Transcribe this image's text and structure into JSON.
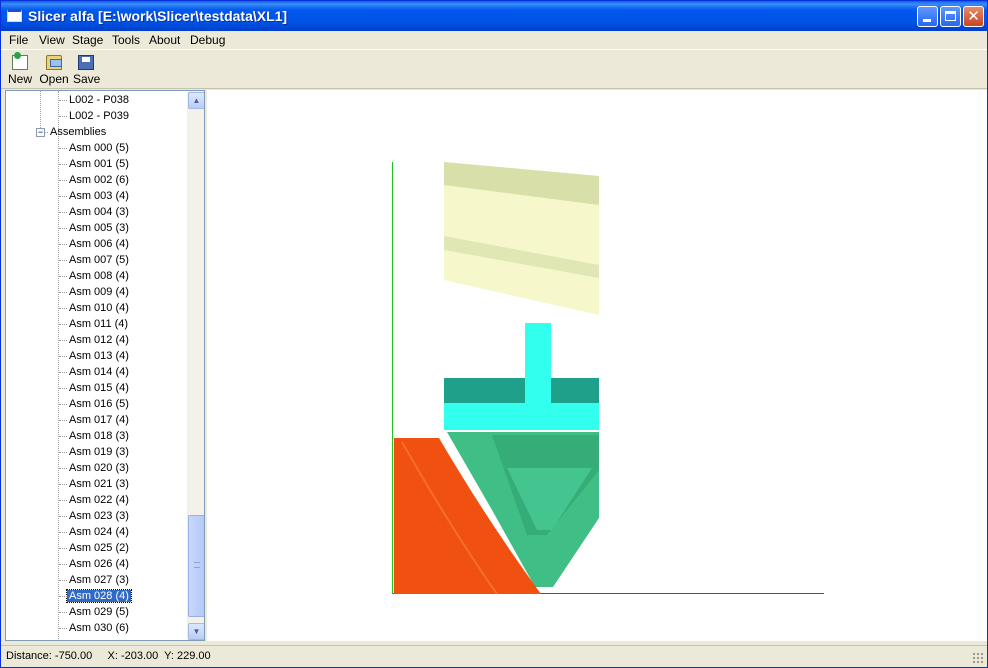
{
  "window": {
    "title": "Slicer alfa [E:\\work\\Slicer\\testdata\\XL1]"
  },
  "menu": [
    "File",
    "View",
    "Stage",
    "Tools",
    "About",
    "Debug"
  ],
  "toolbar": {
    "new_label": "New",
    "open_label": "Open",
    "save_label": "Save"
  },
  "tree": {
    "parts": [
      "L002 - P038",
      "L002 - P039"
    ],
    "group_label": "Assemblies",
    "assemblies": [
      "Asm 000 (5)",
      "Asm 001 (5)",
      "Asm 002 (6)",
      "Asm 003 (4)",
      "Asm 004 (3)",
      "Asm 005 (3)",
      "Asm 006 (4)",
      "Asm 007 (5)",
      "Asm 008 (4)",
      "Asm 009 (4)",
      "Asm 010 (4)",
      "Asm 011 (4)",
      "Asm 012 (4)",
      "Asm 013 (4)",
      "Asm 014 (4)",
      "Asm 015 (4)",
      "Asm 016 (5)",
      "Asm 017 (4)",
      "Asm 018 (3)",
      "Asm 019 (3)",
      "Asm 020 (3)",
      "Asm 021 (3)",
      "Asm 022 (4)",
      "Asm 023 (3)",
      "Asm 024 (4)",
      "Asm 025 (2)",
      "Asm 026 (4)",
      "Asm 027 (3)",
      "Asm 028 (4)",
      "Asm 029 (5)",
      "Asm 030 (6)"
    ],
    "selected": "Asm 028 (4)"
  },
  "status": {
    "text": "Distance: -750.00     X: -203.00  Y: 229.00"
  },
  "colors": {
    "axis_y": "#22c322",
    "axis_x": "#d02020",
    "part_yellow": "#f6f8cc",
    "part_cyan": "#33ffee",
    "part_teal": "#1fa08a",
    "part_green": "#3fbf85",
    "part_orange": "#f05010"
  }
}
